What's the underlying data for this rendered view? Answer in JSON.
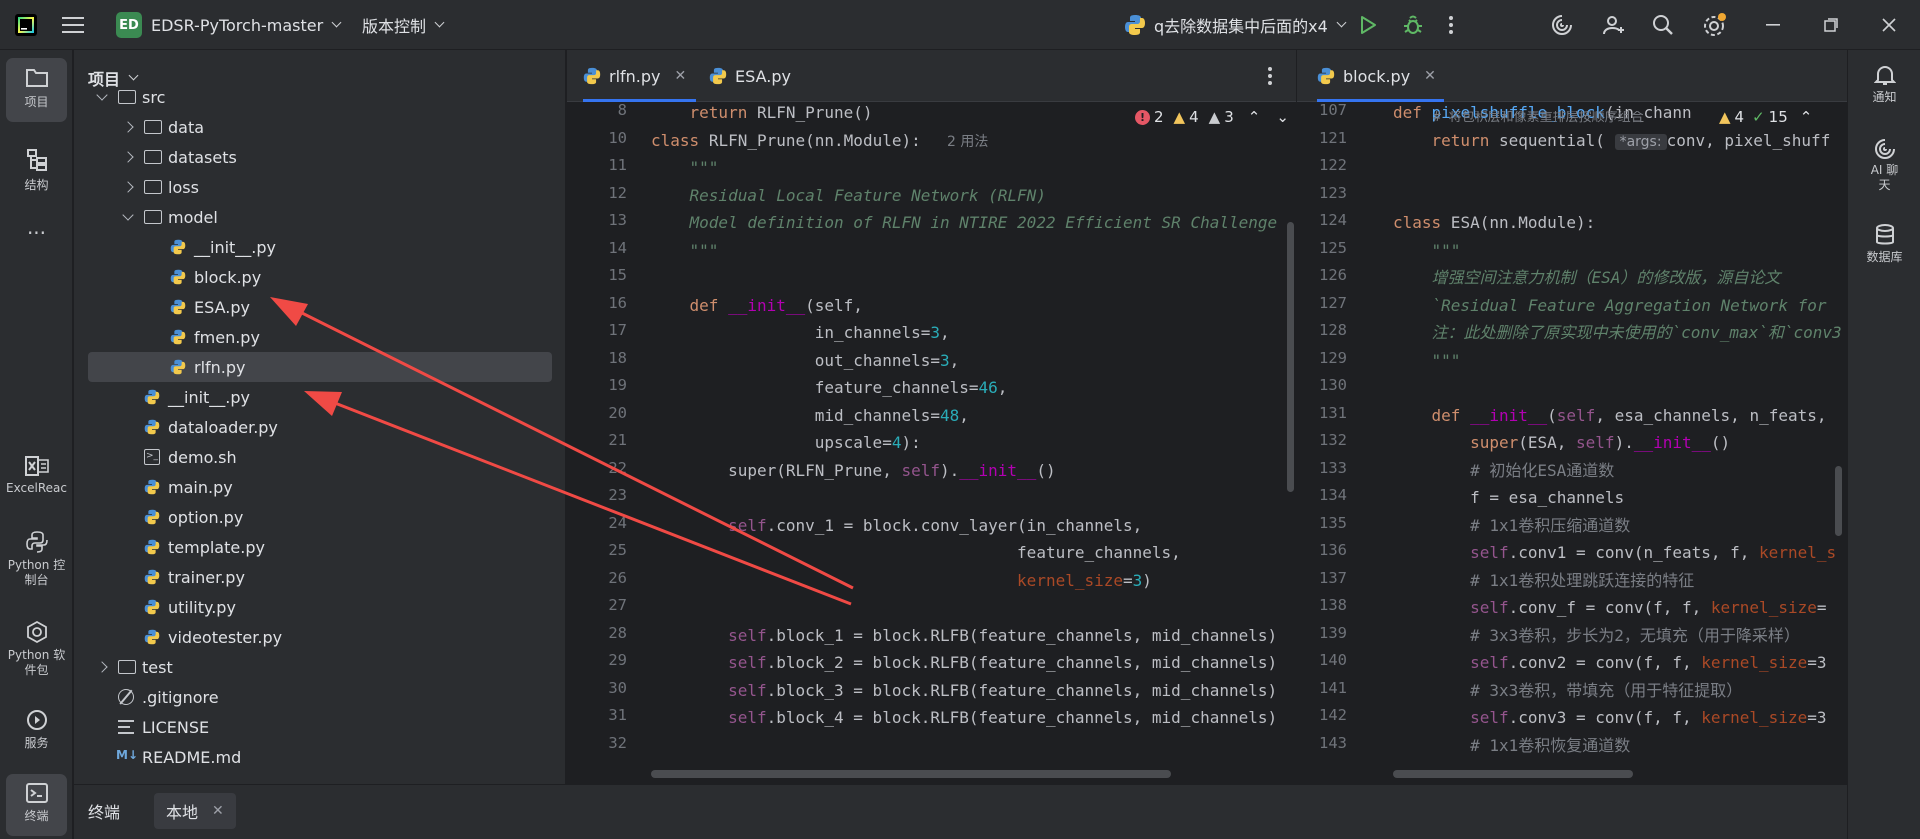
{
  "titlebar": {
    "project_badge": "ED",
    "project_name": "EDSR-PyTorch-master",
    "vcs_label": "版本控制",
    "run_config": "q去除数据集中后面的x4"
  },
  "left_toolbar": [
    {
      "label": "项目",
      "icon": "folder-icon"
    },
    {
      "label": "结构",
      "icon": "structure-icon"
    },
    {
      "label": "...",
      "icon": "more-icon"
    },
    {
      "label": "ExcelReac",
      "icon": "excel-icon"
    },
    {
      "label": "Python 控制台",
      "icon": "python-console-icon"
    },
    {
      "label": "Python 软件包",
      "icon": "python-packages-icon"
    },
    {
      "label": "服务",
      "icon": "services-icon"
    },
    {
      "label": "终端",
      "icon": "terminal-icon"
    }
  ],
  "right_toolbar": [
    {
      "label": "通知",
      "icon": "bell-icon"
    },
    {
      "label": "AI 聊天",
      "icon": "ai-chat-icon"
    },
    {
      "label": "数据库",
      "icon": "database-icon"
    }
  ],
  "project_panel": {
    "title": "项目",
    "tree": [
      {
        "name": "src",
        "type": "folder",
        "expanded": true,
        "depth": 0
      },
      {
        "name": "data",
        "type": "folder",
        "expanded": false,
        "depth": 1
      },
      {
        "name": "datasets",
        "type": "folder",
        "expanded": false,
        "depth": 1
      },
      {
        "name": "loss",
        "type": "folder",
        "expanded": false,
        "depth": 1
      },
      {
        "name": "model",
        "type": "folder",
        "expanded": true,
        "depth": 1
      },
      {
        "name": "__init__.py",
        "type": "py",
        "depth": 2
      },
      {
        "name": "block.py",
        "type": "py",
        "depth": 2
      },
      {
        "name": "ESA.py",
        "type": "py",
        "depth": 2
      },
      {
        "name": "fmen.py",
        "type": "py",
        "depth": 2
      },
      {
        "name": "rlfn.py",
        "type": "py",
        "depth": 2,
        "selected": true
      },
      {
        "name": "__init__.py",
        "type": "py",
        "depth": 1
      },
      {
        "name": "dataloader.py",
        "type": "py",
        "depth": 1
      },
      {
        "name": "demo.sh",
        "type": "sh",
        "depth": 1
      },
      {
        "name": "main.py",
        "type": "py",
        "depth": 1
      },
      {
        "name": "option.py",
        "type": "py",
        "depth": 1
      },
      {
        "name": "template.py",
        "type": "py",
        "depth": 1
      },
      {
        "name": "trainer.py",
        "type": "py",
        "depth": 1
      },
      {
        "name": "utility.py",
        "type": "py",
        "depth": 1
      },
      {
        "name": "videotester.py",
        "type": "py",
        "depth": 1
      },
      {
        "name": "test",
        "type": "folder",
        "expanded": false,
        "depth": 0
      },
      {
        "name": ".gitignore",
        "type": "gitignore",
        "depth": 0
      },
      {
        "name": "LICENSE",
        "type": "text",
        "depth": 0
      },
      {
        "name": "README.md",
        "type": "md",
        "depth": 0
      }
    ]
  },
  "editor_left": {
    "tabs": [
      {
        "label": "rlfn.py",
        "active": true
      },
      {
        "label": "ESA.py",
        "active": false
      }
    ],
    "inspection": {
      "errors": "2",
      "warnings": "4",
      "weak": "3"
    },
    "usages_hint": "2 用法",
    "line_numbers": [
      "8",
      "10",
      "11",
      "12",
      "13",
      "14",
      "15",
      "16",
      "17",
      "18",
      "19",
      "20",
      "21",
      "22",
      "23",
      "24",
      "25",
      "26",
      "27",
      "28",
      "29",
      "30",
      "31",
      "32"
    ],
    "lines": [
      {
        "ln": "8",
        "parts": [
          [
            "",
            "    "
          ],
          [
            "kw",
            "return"
          ],
          [
            "",
            " RLFN_Prune()"
          ]
        ]
      },
      {
        "ln": "10",
        "parts": [
          [
            "kw",
            "class"
          ],
          [
            "",
            " "
          ],
          [
            "",
            "RLFN_Prune"
          ],
          [
            "",
            "(nn.Module):"
          ]
        ]
      },
      {
        "ln": "11",
        "parts": [
          [
            "cm",
            "    \"\"\""
          ]
        ]
      },
      {
        "ln": "12",
        "parts": [
          [
            "cm",
            "    Residual Local Feature Network (RLFN)"
          ]
        ]
      },
      {
        "ln": "13",
        "parts": [
          [
            "cm",
            "    Model definition of RLFN in NTIRE 2022 Efficient SR Challenge"
          ]
        ]
      },
      {
        "ln": "14",
        "parts": [
          [
            "cm",
            "    \"\"\""
          ]
        ]
      },
      {
        "ln": "15",
        "parts": []
      },
      {
        "ln": "16",
        "parts": [
          [
            "",
            "    "
          ],
          [
            "kw",
            "def"
          ],
          [
            "",
            " "
          ],
          [
            "dund",
            "__init__"
          ],
          [
            "",
            "(self,"
          ]
        ]
      },
      {
        "ln": "17",
        "parts": [
          [
            "",
            "                 in_channels="
          ],
          [
            "num",
            "3"
          ],
          [
            "",
            ","
          ]
        ]
      },
      {
        "ln": "18",
        "parts": [
          [
            "",
            "                 out_channels="
          ],
          [
            "num",
            "3"
          ],
          [
            "",
            ","
          ]
        ]
      },
      {
        "ln": "19",
        "parts": [
          [
            "",
            "                 feature_channels="
          ],
          [
            "num",
            "46"
          ],
          [
            "",
            ","
          ]
        ]
      },
      {
        "ln": "20",
        "parts": [
          [
            "",
            "                 mid_channels="
          ],
          [
            "num",
            "48"
          ],
          [
            "",
            ","
          ]
        ]
      },
      {
        "ln": "21",
        "parts": [
          [
            "",
            "                 upscale="
          ],
          [
            "num",
            "4"
          ],
          [
            "",
            "):"
          ]
        ]
      },
      {
        "ln": "22",
        "parts": [
          [
            "",
            "        super(RLFN_Prune, "
          ],
          [
            "self",
            "self"
          ],
          [
            "",
            ")."
          ],
          [
            "dund",
            "__init__"
          ],
          [
            "",
            "()"
          ]
        ]
      },
      {
        "ln": "23",
        "parts": []
      },
      {
        "ln": "24",
        "parts": [
          [
            "",
            "        "
          ],
          [
            "self",
            "self"
          ],
          [
            "",
            ".conv_1 = block.conv_layer(in_channels,"
          ]
        ]
      },
      {
        "ln": "25",
        "parts": [
          [
            "",
            "                                      feature_channels,"
          ]
        ]
      },
      {
        "ln": "26",
        "parts": [
          [
            "",
            "                                      "
          ],
          [
            "par",
            "kernel_size"
          ],
          [
            "",
            "="
          ],
          [
            "num",
            "3"
          ],
          [
            "",
            ")"
          ]
        ]
      },
      {
        "ln": "27",
        "parts": []
      },
      {
        "ln": "28",
        "parts": [
          [
            "",
            "        "
          ],
          [
            "self",
            "self"
          ],
          [
            "",
            ".block_1 = block.RLFB(feature_channels, mid_channels)"
          ]
        ]
      },
      {
        "ln": "29",
        "parts": [
          [
            "",
            "        "
          ],
          [
            "self",
            "self"
          ],
          [
            "",
            ".block_2 = block.RLFB(feature_channels, mid_channels)"
          ]
        ]
      },
      {
        "ln": "30",
        "parts": [
          [
            "",
            "        "
          ],
          [
            "self",
            "self"
          ],
          [
            "",
            ".block_3 = block.RLFB(feature_channels, mid_channels)"
          ]
        ]
      },
      {
        "ln": "31",
        "parts": [
          [
            "",
            "        "
          ],
          [
            "self",
            "self"
          ],
          [
            "",
            ".block_4 = block.RLFB(feature_channels, mid_channels)"
          ]
        ]
      },
      {
        "ln": "32",
        "parts": []
      }
    ]
  },
  "editor_right": {
    "tabs": [
      {
        "label": "block.py",
        "active": true
      }
    ],
    "inspection": {
      "warnings": "4",
      "weak": "15"
    },
    "lines": [
      {
        "ln": "107",
        "parts": [
          [
            "kw",
            "def"
          ],
          [
            "",
            " "
          ],
          [
            "fn",
            "pixelshuffle_block"
          ],
          [
            "",
            "(in_chann"
          ]
        ]
      },
      {
        "ln": "121",
        "parts": [
          [
            "",
            "    "
          ],
          [
            "kw",
            "return"
          ],
          [
            "",
            " sequential( "
          ],
          [
            "hb",
            "*args:"
          ],
          [
            "",
            "conv, pixel_shuff"
          ]
        ]
      },
      {
        "ln": "122",
        "parts": []
      },
      {
        "ln": "123",
        "parts": []
      },
      {
        "ln": "124",
        "parts": [
          [
            "kw",
            "class"
          ],
          [
            "",
            " ESA(nn.Module):"
          ]
        ]
      },
      {
        "ln": "125",
        "parts": [
          [
            "cm",
            "    \"\"\""
          ]
        ]
      },
      {
        "ln": "126",
        "parts": [
          [
            "cm",
            "    增强空间注意力机制（ESA）的修改版，源自论文"
          ]
        ]
      },
      {
        "ln": "127",
        "parts": [
          [
            "cm",
            "    `Residual Feature Aggregation Network for"
          ]
        ]
      },
      {
        "ln": "128",
        "parts": [
          [
            "cm",
            "    注：此处删除了原实现中未使用的`conv_max`和`conv3"
          ]
        ]
      },
      {
        "ln": "129",
        "parts": [
          [
            "cm",
            "    \"\"\""
          ]
        ]
      },
      {
        "ln": "130",
        "parts": []
      },
      {
        "ln": "131",
        "parts": [
          [
            "",
            "    "
          ],
          [
            "kw",
            "def"
          ],
          [
            "",
            " "
          ],
          [
            "dund",
            "__init__"
          ],
          [
            "",
            "("
          ],
          [
            "self",
            "self"
          ],
          [
            "",
            ", esa_channels, n_feats,"
          ]
        ]
      },
      {
        "ln": "132",
        "parts": [
          [
            "",
            "        "
          ],
          [
            "kw",
            "super"
          ],
          [
            "",
            "(ESA, "
          ],
          [
            "self",
            "self"
          ],
          [
            "",
            ")."
          ],
          [
            "dund",
            "__init__"
          ],
          [
            "",
            "()"
          ]
        ]
      },
      {
        "ln": "133",
        "parts": [
          [
            "cmz",
            "        # 初始化ESA通道数"
          ]
        ]
      },
      {
        "ln": "134",
        "parts": [
          [
            "",
            "        f = esa_channels"
          ]
        ]
      },
      {
        "ln": "135",
        "parts": [
          [
            "cmz",
            "        # 1x1卷积压缩通道数"
          ]
        ]
      },
      {
        "ln": "136",
        "parts": [
          [
            "",
            "        "
          ],
          [
            "self",
            "self"
          ],
          [
            "",
            ".conv1 = conv(n_feats, f, "
          ],
          [
            "par",
            "kernel_s"
          ]
        ]
      },
      {
        "ln": "137",
        "parts": [
          [
            "cmz",
            "        # 1x1卷积处理跳跃连接的特征"
          ]
        ]
      },
      {
        "ln": "138",
        "parts": [
          [
            "",
            "        "
          ],
          [
            "self",
            "self"
          ],
          [
            "",
            ".conv_f = conv(f, f, "
          ],
          [
            "par",
            "kernel_size"
          ],
          [
            "",
            "="
          ]
        ]
      },
      {
        "ln": "139",
        "parts": [
          [
            "cmz",
            "        # 3x3卷积，步长为2，无填充（用于降采样）"
          ]
        ]
      },
      {
        "ln": "140",
        "parts": [
          [
            "",
            "        "
          ],
          [
            "self",
            "self"
          ],
          [
            "",
            ".conv2 = conv(f, f, "
          ],
          [
            "par",
            "kernel_size"
          ],
          [
            "",
            "=3"
          ]
        ]
      },
      {
        "ln": "141",
        "parts": [
          [
            "cmz",
            "        # 3x3卷积，带填充（用于特征提取）"
          ]
        ]
      },
      {
        "ln": "142",
        "parts": [
          [
            "",
            "        "
          ],
          [
            "self",
            "self"
          ],
          [
            "",
            ".conv3 = conv(f, f, "
          ],
          [
            "par",
            "kernel_size"
          ],
          [
            "",
            "=3"
          ]
        ]
      },
      {
        "ln": "143",
        "parts": [
          [
            "cmz",
            "        # 1x1卷积恢复通道数"
          ]
        ]
      }
    ],
    "sticky_hint": "# 将包积层和像素重排层按顺序组合"
  },
  "bottom_panel": {
    "tabs": [
      {
        "label": "终端",
        "active": false
      },
      {
        "label": "本地",
        "active": true
      }
    ]
  },
  "colors": {
    "accent": "#3574f0",
    "arrow": "#f04a45",
    "keyword": "#cf8e6d"
  }
}
